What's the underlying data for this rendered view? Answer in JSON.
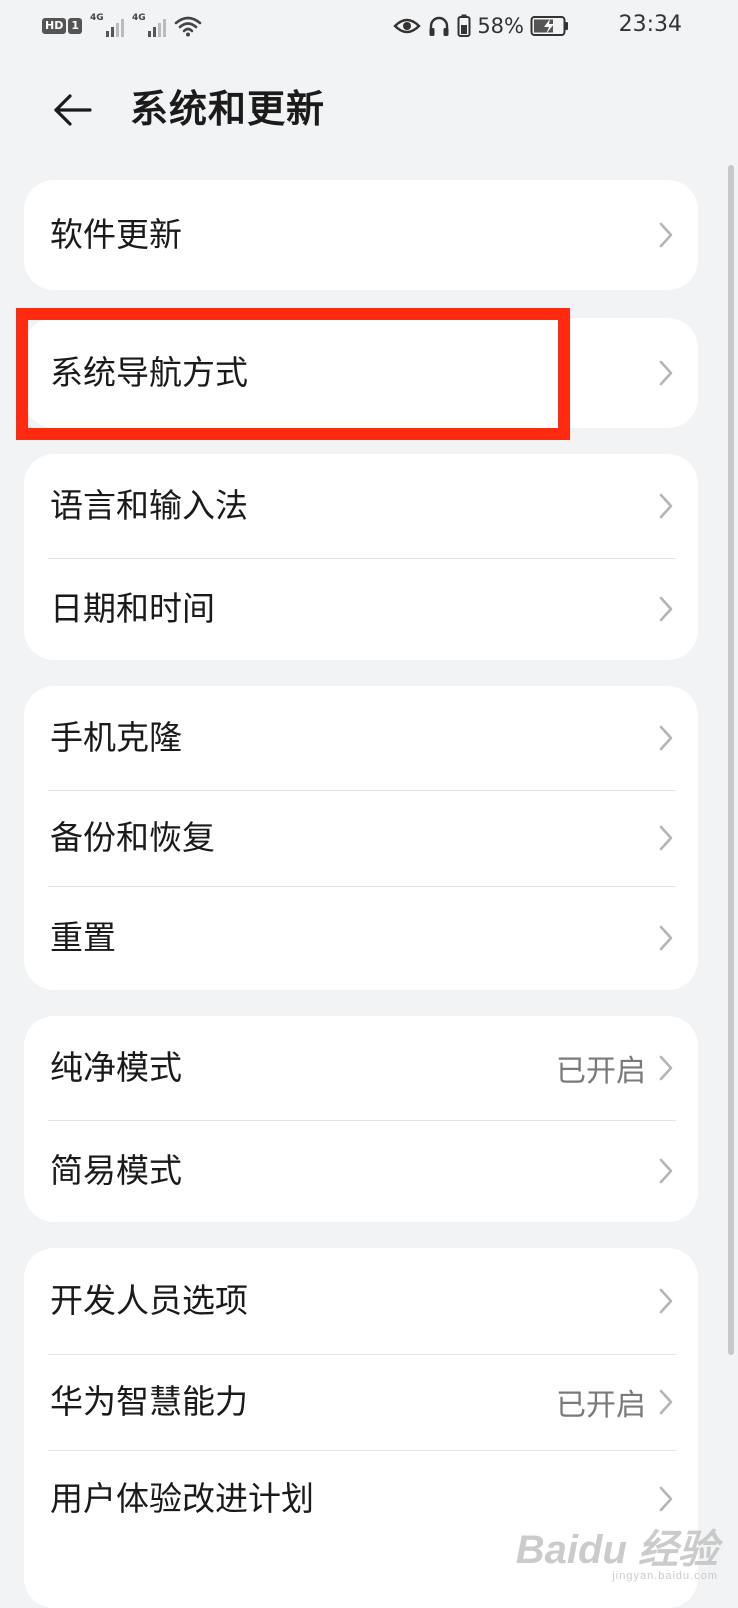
{
  "status_bar": {
    "hd_label": "HD",
    "sim_label": "1",
    "network_1": "4G",
    "network_2": "4G",
    "battery_percent": "58%",
    "time": "23:34",
    "icons": [
      "eye-icon",
      "headphones-icon",
      "battery-icon",
      "charging-icon",
      "wifi-icon"
    ]
  },
  "header": {
    "title": "系统和更新",
    "back_icon": "back-arrow-icon"
  },
  "groups": [
    {
      "items": [
        {
          "label": "软件更新",
          "value": ""
        }
      ]
    },
    {
      "items": [
        {
          "label": "系统导航方式",
          "value": ""
        }
      ]
    },
    {
      "items": [
        {
          "label": "语言和输入法",
          "value": ""
        },
        {
          "label": "日期和时间",
          "value": ""
        }
      ]
    },
    {
      "items": [
        {
          "label": "手机克隆",
          "value": ""
        },
        {
          "label": "备份和恢复",
          "value": ""
        },
        {
          "label": "重置",
          "value": ""
        }
      ]
    },
    {
      "items": [
        {
          "label": "纯净模式",
          "value": "已开启"
        },
        {
          "label": "简易模式",
          "value": ""
        }
      ]
    },
    {
      "items": [
        {
          "label": "开发人员选项",
          "value": ""
        },
        {
          "label": "华为智慧能力",
          "value": "已开启"
        },
        {
          "label": "用户体验改进计划",
          "value": ""
        }
      ]
    }
  ],
  "colors": {
    "background": "#f1f3f5",
    "card": "#ffffff",
    "highlight": "#ff2a10",
    "secondary_text": "#7a7a7a"
  },
  "watermark": {
    "main": "Baidu 经验",
    "sub": "jingyan.baidu.com"
  }
}
